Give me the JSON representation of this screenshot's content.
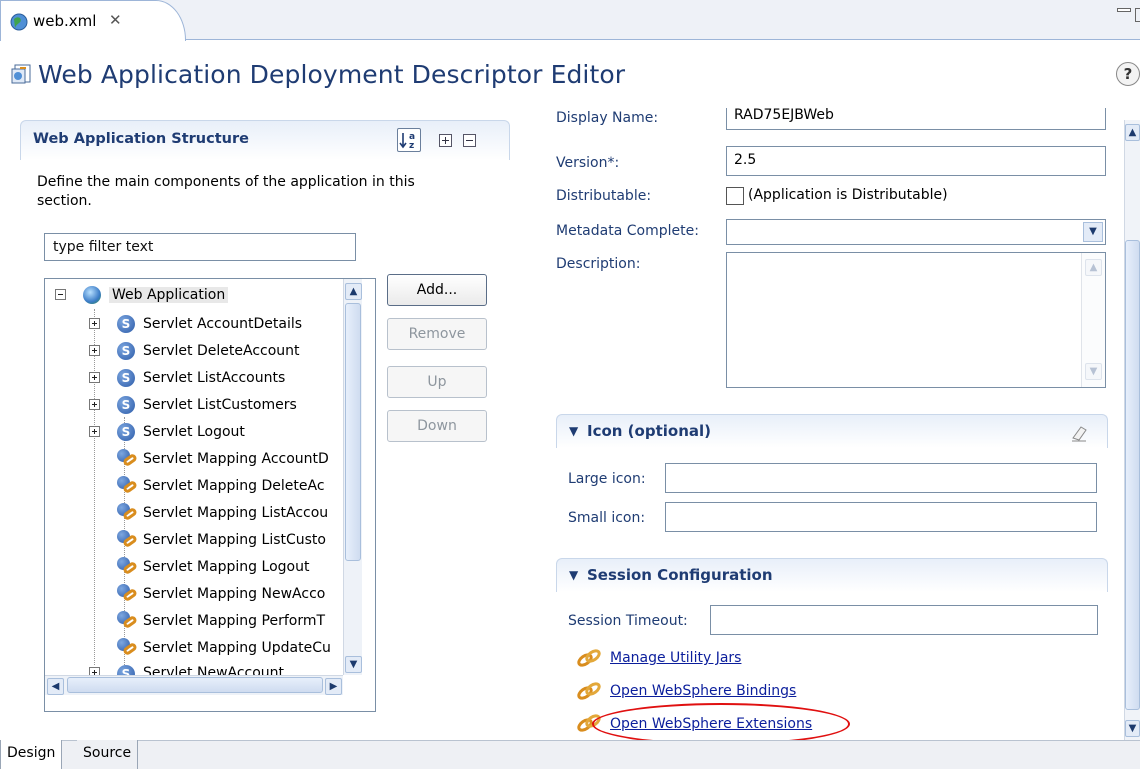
{
  "editor_tab": {
    "title": "web.xml",
    "close_glyph": "✕"
  },
  "editor": {
    "title": "Web Application Deployment Descriptor Editor",
    "help_glyph": "?"
  },
  "left_section": {
    "title": "Web Application Structure",
    "description": "Define the main components of the application in this section.",
    "filter_value": "type filter text",
    "sort_icon": "sort-alphabetical-icon",
    "tree": [
      {
        "label": "Web Application",
        "type": "root",
        "expanded": true
      },
      {
        "label": "Servlet AccountDetails",
        "type": "servlet"
      },
      {
        "label": "Servlet DeleteAccount",
        "type": "servlet"
      },
      {
        "label": "Servlet ListAccounts",
        "type": "servlet"
      },
      {
        "label": "Servlet ListCustomers",
        "type": "servlet"
      },
      {
        "label": "Servlet Logout",
        "type": "servlet"
      },
      {
        "label": "Servlet Mapping AccountD",
        "type": "mapping"
      },
      {
        "label": "Servlet Mapping DeleteAc",
        "type": "mapping"
      },
      {
        "label": "Servlet Mapping ListAccou",
        "type": "mapping"
      },
      {
        "label": "Servlet Mapping ListCusto",
        "type": "mapping"
      },
      {
        "label": "Servlet Mapping Logout",
        "type": "mapping"
      },
      {
        "label": "Servlet Mapping NewAcco",
        "type": "mapping"
      },
      {
        "label": "Servlet Mapping PerformT",
        "type": "mapping"
      },
      {
        "label": "Servlet Mapping UpdateCu",
        "type": "mapping"
      },
      {
        "label": "Servlet NewAccount",
        "type": "servlet"
      }
    ],
    "buttons": {
      "add": "Add...",
      "remove": "Remove",
      "up": "Up",
      "down": "Down"
    }
  },
  "general": {
    "display_name_label": "Display Name:",
    "display_name_value": "RAD75EJBWeb",
    "version_label": "Version*:",
    "version_value": "2.5",
    "distributable_label": "Distributable:",
    "distributable_checkbox": "(Application is Distributable)",
    "metadata_label": "Metadata Complete:",
    "metadata_value": "",
    "description_label": "Description:",
    "description_value": ""
  },
  "icon_section": {
    "title": "Icon (optional)",
    "large_label": "Large icon:",
    "large_value": "",
    "small_label": "Small icon:",
    "small_value": ""
  },
  "session_section": {
    "title": "Session Configuration",
    "timeout_label": "Session Timeout:",
    "timeout_value": ""
  },
  "links": {
    "manage_jars": "Manage Utility Jars",
    "bindings": "Open WebSphere Bindings",
    "extensions": "Open WebSphere Extensions"
  },
  "bottom_tabs": {
    "design": "Design",
    "source": "Source"
  },
  "colors": {
    "title_blue": "#1f3c73",
    "link_blue": "#0b1e9c",
    "highlight_red": "#e01010"
  }
}
